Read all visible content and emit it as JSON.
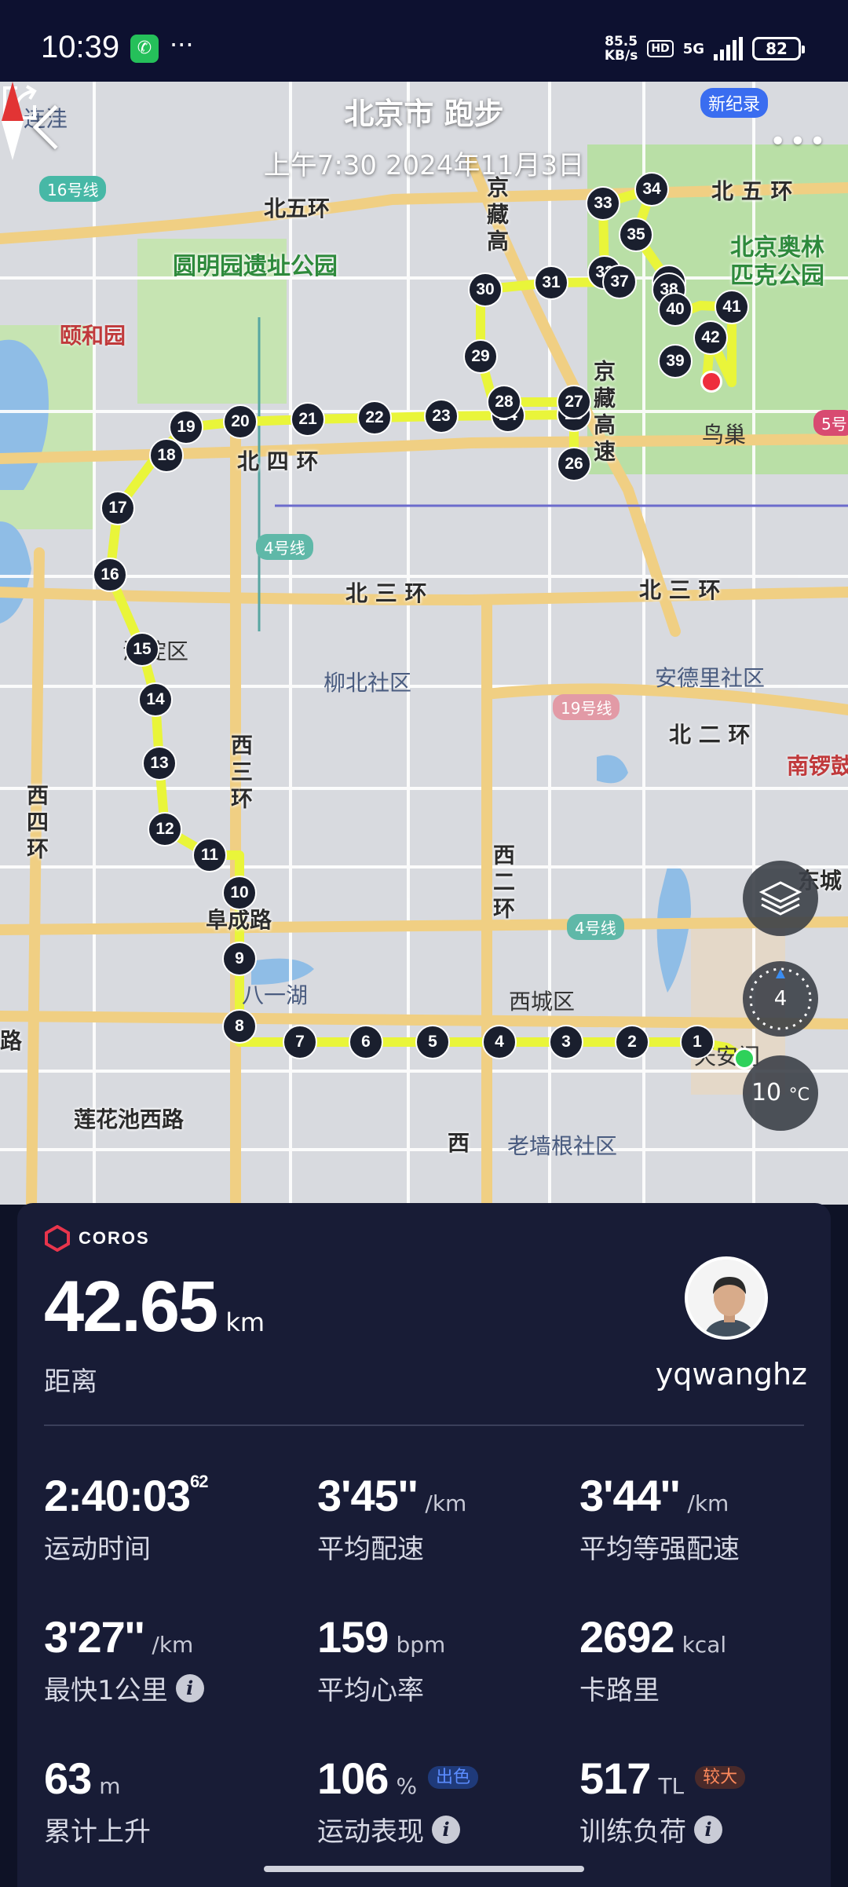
{
  "status_bar": {
    "time": "10:39",
    "more": "···",
    "speed_top": "85.5",
    "speed_bottom": "KB/s",
    "hd": "HD",
    "network": "5G",
    "battery": "82"
  },
  "header": {
    "title": "北京市 跑步",
    "subtitle": "上午7:30 2024年11月3日",
    "new_record_badge": "新纪录",
    "more": "•••"
  },
  "map": {
    "labels": {
      "malianwa": "马连洼",
      "line16": "16号线",
      "north5ring_left": "北五环",
      "north5ring_right": "北 五 环",
      "jingzang1": "京藏高",
      "jingzang2": "京藏高速",
      "yuanmingyuan": "圆明园遗址公园",
      "olympic1": "北京奥林",
      "olympic2": "匹克公园",
      "summer_palace": "颐和园",
      "birds_nest": "鸟巢",
      "line5": "5号",
      "north4ring": "北 四 环",
      "line4a": "4号线",
      "north3ring_left": "北 三 环",
      "north3ring_right": "北 三 环",
      "haidian": "海淀区",
      "liubei": "柳北社区",
      "line19": "19号线",
      "andeli": "安德里社区",
      "north2ring": "北 二 环",
      "nanluo": "南锣鼓",
      "west3ring": "西三环",
      "west4ring": "西四环",
      "dongcheng": "东城",
      "west2ring": "西二环",
      "line4b": "4号线",
      "fuchenglu": "阜成路",
      "bayihu": "八一湖",
      "xicheng": "西城区",
      "tiananmen": "天安门",
      "lianhuachi": "莲花池西路",
      "laoqianggen": "老墙根社区",
      "xi": "西",
      "lu": "路"
    },
    "markers": [
      "1",
      "2",
      "3",
      "4",
      "5",
      "6",
      "7",
      "8",
      "9",
      "10",
      "11",
      "12",
      "13",
      "14",
      "15",
      "16",
      "17",
      "18",
      "19",
      "20",
      "21",
      "22",
      "23",
      "24",
      "25",
      "26",
      "27",
      "28",
      "29",
      "30",
      "31",
      "32",
      "33",
      "34",
      "35",
      "36",
      "37",
      "38",
      "39",
      "40",
      "41",
      "42"
    ],
    "speed_button": "4",
    "temperature": "10",
    "temperature_unit": "°C",
    "colors": {
      "route": "#e9f53a",
      "park": "#b9dfa6",
      "road": "#f0cf83",
      "water": "#8fbde6"
    }
  },
  "card": {
    "logo": "COROS",
    "distance": "42.65",
    "distance_unit": "km",
    "distance_label": "距离",
    "username": "yqwanghz",
    "stats": [
      {
        "value": "2:40:03",
        "sup": "62",
        "unit": "",
        "label": "运动时间"
      },
      {
        "value": "3'45''",
        "unit": "/km",
        "label": "平均配速"
      },
      {
        "value": "3'44''",
        "unit": "/km",
        "label": "平均等强配速"
      },
      {
        "value": "3'27''",
        "unit": "/km",
        "label": "最快1公里"
      },
      {
        "value": "159",
        "unit": "bpm",
        "label": "平均心率"
      },
      {
        "value": "2692",
        "unit": "kcal",
        "label": "卡路里"
      },
      {
        "value": "63",
        "unit": "m",
        "label": "累计上升"
      },
      {
        "value": "106",
        "unit": "%",
        "tag": "出色",
        "label": "运动表现"
      },
      {
        "value": "517",
        "unit": "TL",
        "tag": "较大",
        "label": "训练负荷"
      }
    ],
    "info_icon": "i"
  }
}
